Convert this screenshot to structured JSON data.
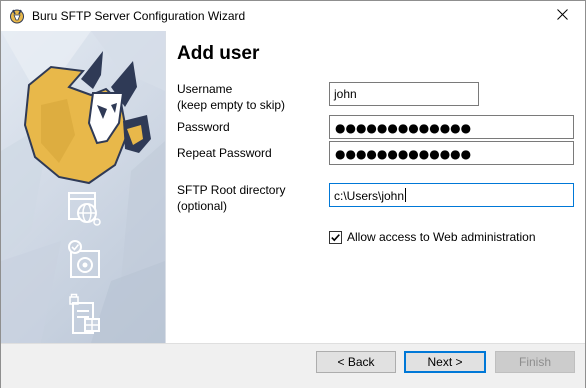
{
  "window": {
    "title": "Buru SFTP Server Configuration Wizard"
  },
  "page": {
    "heading": "Add user"
  },
  "form": {
    "username": {
      "label_line1": "Username",
      "label_line2": "(keep empty to skip)",
      "value": "john"
    },
    "password": {
      "label": "Password",
      "masked_value": "●●●●●●●●●●●●●"
    },
    "repeat_password": {
      "label": "Repeat Password",
      "masked_value": "●●●●●●●●●●●●●"
    },
    "root_directory": {
      "label_line1": "SFTP Root directory",
      "label_line2": "(optional)",
      "value": "c:\\Users\\john"
    },
    "web_admin": {
      "label": "Allow access to Web administration",
      "checked": true
    }
  },
  "buttons": {
    "back": "< Back",
    "next": "Next >",
    "finish": "Finish"
  },
  "sidebar": {
    "icons": [
      "globe-settings-icon",
      "secure-drive-icon",
      "secure-server-icon"
    ]
  },
  "colors": {
    "accent": "#0078d7",
    "logo_gold": "#e8b84a",
    "logo_dark": "#2f3a56"
  }
}
